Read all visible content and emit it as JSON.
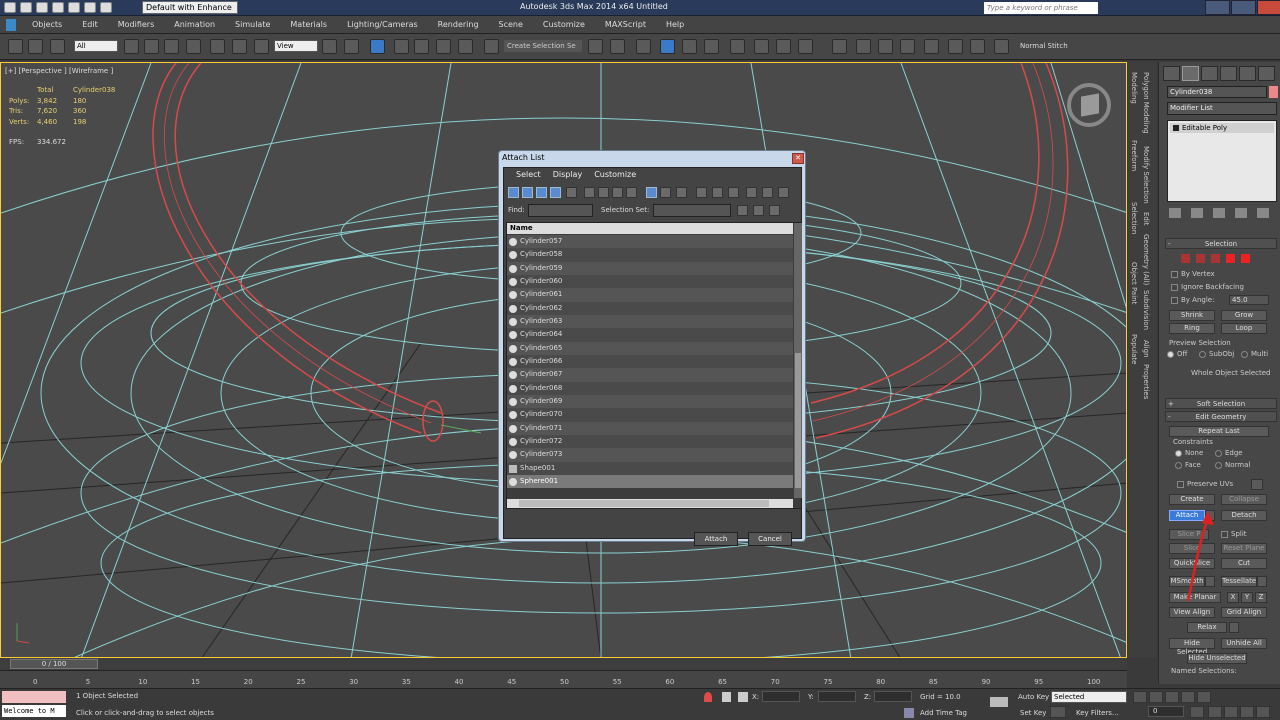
{
  "titlebar": {
    "workspace": "Default with Enhance",
    "title": "Autodesk 3ds Max  2014 x64      Untitled",
    "search_placeholder": "Type a keyword or phrase"
  },
  "menu": [
    "Objects",
    "Edit",
    "Modifiers",
    "Animation",
    "Simulate",
    "Materials",
    "Lighting/Cameras",
    "Rendering",
    "Scene",
    "Customize",
    "MAXScript",
    "Help"
  ],
  "toolbar": {
    "filter": "All",
    "refcoord": "View",
    "selection_set_placeholder": "Create Selection Se",
    "normal_stitch": "Normal Stitch"
  },
  "viewport": {
    "label": "[+] [Perspective ] [Wireframe ]",
    "stats": {
      "total_header": "Total",
      "object_header": "Cylinder038",
      "rows": [
        {
          "label": "Polys:",
          "total": "3,842",
          "object": "180"
        },
        {
          "label": "Tris:",
          "total": "7,620",
          "object": "360"
        },
        {
          "label": "Verts:",
          "total": "4,460",
          "object": "198"
        }
      ],
      "fps_label": "FPS:",
      "fps_value": "334.672"
    }
  },
  "side_tabs": [
    "Modeling",
    "Freeform",
    "Selection",
    "Object Paint",
    "Populate"
  ],
  "side_tabs2": [
    "Polygon Modeling",
    "Modify Selection",
    "Edit",
    "Geometry (All)",
    "Subdivision",
    "Align",
    "Properties"
  ],
  "dialog": {
    "title": "Attach List",
    "menu": [
      "Select",
      "Display",
      "Customize"
    ],
    "find_label": "Find:",
    "selection_set_label": "Selection Set:",
    "column_header": "Name",
    "items": [
      {
        "name": "Cylinder057",
        "type": "geom"
      },
      {
        "name": "Cylinder058",
        "type": "geom"
      },
      {
        "name": "Cylinder059",
        "type": "geom"
      },
      {
        "name": "Cylinder060",
        "type": "geom"
      },
      {
        "name": "Cylinder061",
        "type": "geom"
      },
      {
        "name": "Cylinder062",
        "type": "geom"
      },
      {
        "name": "Cylinder063",
        "type": "geom"
      },
      {
        "name": "Cylinder064",
        "type": "geom"
      },
      {
        "name": "Cylinder065",
        "type": "geom"
      },
      {
        "name": "Cylinder066",
        "type": "geom"
      },
      {
        "name": "Cylinder067",
        "type": "geom"
      },
      {
        "name": "Cylinder068",
        "type": "geom"
      },
      {
        "name": "Cylinder069",
        "type": "geom"
      },
      {
        "name": "Cylinder070",
        "type": "geom"
      },
      {
        "name": "Cylinder071",
        "type": "geom"
      },
      {
        "name": "Cylinder072",
        "type": "geom"
      },
      {
        "name": "Cylinder073",
        "type": "geom"
      },
      {
        "name": "Shape001",
        "type": "shape"
      },
      {
        "name": "Sphere001",
        "type": "geom",
        "selected": true
      }
    ],
    "attach_button": "Attach",
    "cancel_button": "Cancel"
  },
  "command_panel": {
    "object_name": "Cylinder038",
    "modifier_list": "Modifier List",
    "stack_item": "Editable Poly",
    "selection": {
      "title": "Selection",
      "by_vertex": "By Vertex",
      "ignore_backfacing": "Ignore Backfacing",
      "by_angle": "By Angle:",
      "angle_value": "45.0",
      "shrink": "Shrink",
      "grow": "Grow",
      "ring": "Ring",
      "loop": "Loop",
      "preview_selection": "Preview Selection",
      "off": "Off",
      "subobj": "SubObj",
      "multi": "Multi",
      "status": "Whole Object Selected"
    },
    "soft_selection": "Soft Selection",
    "edit_geometry": {
      "title": "Edit Geometry",
      "repeat_last": "Repeat Last",
      "constraints": "Constraints",
      "none": "None",
      "edge": "Edge",
      "face": "Face",
      "normal": "Normal",
      "preserve_uvs": "Preserve UVs",
      "create": "Create",
      "collapse": "Collapse",
      "attach": "Attach",
      "detach": "Detach",
      "slice_plane": "Slice P",
      "split": "Split",
      "slice": "Slice",
      "reset_plane": "Reset Plane",
      "quickslice": "QuickSlice",
      "cut": "Cut",
      "msmooth": "MSmooth",
      "tessellate": "Tessellate",
      "make_planar": "Make Planar",
      "x": "X",
      "y": "Y",
      "z": "Z",
      "view_align": "View Align",
      "grid_align": "Grid Align",
      "relax": "Relax",
      "hide_selected": "Hide Selected",
      "unhide_all": "Unhide All",
      "hide_unselected": "Hide Unselected",
      "named_selections": "Named Selections:"
    }
  },
  "timeline": {
    "slider": "0 / 100",
    "ticks": [
      "0",
      "5",
      "10",
      "15",
      "20",
      "25",
      "30",
      "35",
      "40",
      "45",
      "50",
      "55",
      "60",
      "65",
      "70",
      "75",
      "80",
      "85",
      "90",
      "95",
      "100"
    ]
  },
  "status": {
    "maxscript": "Welcome to M",
    "objects_selected": "1 Object Selected",
    "prompt": "Click or click-and-drag to select objects",
    "x_label": "X:",
    "y_label": "Y:",
    "z_label": "Z:",
    "grid": "Grid = 10.0",
    "add_time_tag": "Add Time Tag",
    "auto_key": "Auto Key",
    "auto_key_value": "Selected",
    "set_key": "Set Key",
    "key_filters": "Key Filters...",
    "frame": "0"
  },
  "colors": {
    "accent": "#3a7ad8",
    "wire_red": "#d84a4a",
    "wire_cyan": "#8ad0d0",
    "viewport_border": "#ffcc33"
  }
}
